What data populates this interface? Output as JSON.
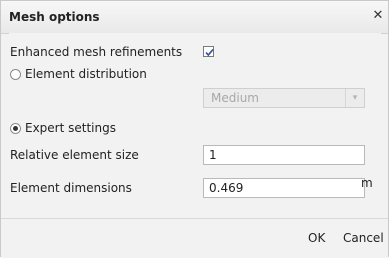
{
  "dialog": {
    "title": "Mesh options",
    "close_symbol": "✕"
  },
  "options": {
    "enhanced_refinements": {
      "label": "Enhanced mesh refinements",
      "checked": true
    },
    "element_distribution": {
      "label": "Element distribution",
      "selected": false
    },
    "distribution_select": {
      "value": "Medium",
      "disabled": true
    },
    "expert_settings": {
      "label": "Expert settings",
      "selected": true
    },
    "relative_element_size": {
      "label": "Relative element size",
      "value": "1"
    },
    "element_dimensions": {
      "label": "Element dimensions",
      "value": "0.469",
      "unit": "m"
    }
  },
  "footer": {
    "ok_label": "OK",
    "cancel_label": "Cancel"
  },
  "icons": {
    "close": "close-icon",
    "checkmark": "checkmark-icon",
    "dropdown": "chevron-down-icon"
  }
}
